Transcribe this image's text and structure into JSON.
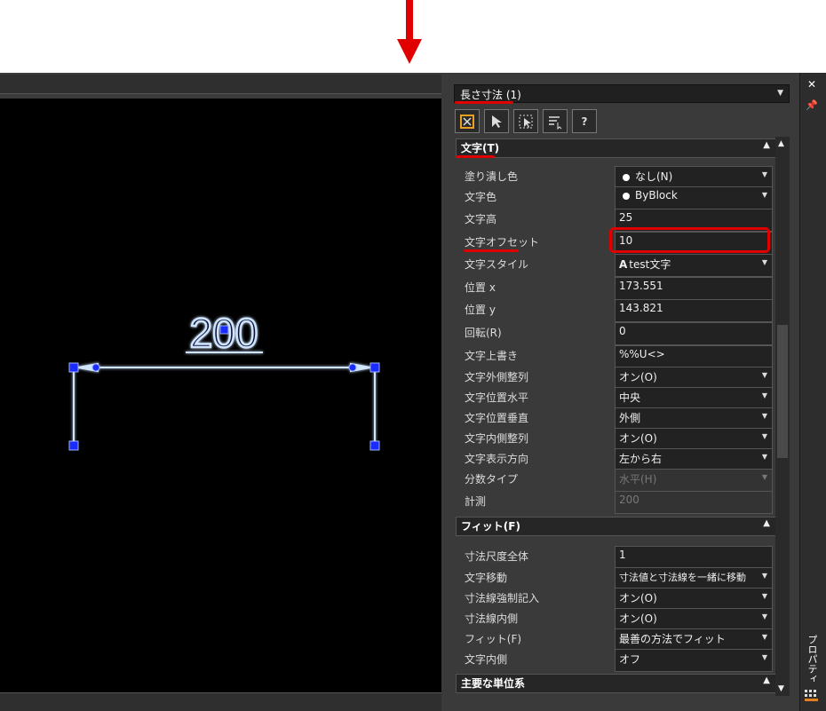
{
  "selector": {
    "value": "長さ寸法 (1)"
  },
  "toolbar": {
    "help_label": "?"
  },
  "sections": {
    "text": {
      "title": "文字(T)"
    },
    "fit": {
      "title": "フィット(F)"
    },
    "units": {
      "title": "主要な単位系"
    }
  },
  "text_props": [
    {
      "label": "塗り潰し色",
      "value": "なし(N)"
    },
    {
      "label": "文字色",
      "value": "ByBlock"
    },
    {
      "label": "文字高",
      "value": "25"
    },
    {
      "label": "文字オフセット",
      "value": "10"
    },
    {
      "label": "文字スタイル",
      "value": "test文字"
    },
    {
      "label": "位置 x",
      "value": "173.551"
    },
    {
      "label": "位置 y",
      "value": "143.821"
    },
    {
      "label": "回転(R)",
      "value": "0"
    },
    {
      "label": "文字上書き",
      "value": "%%U<>"
    },
    {
      "label": "文字外側整列",
      "value": "オン(O)"
    },
    {
      "label": "文字位置水平",
      "value": "中央"
    },
    {
      "label": "文字位置垂直",
      "value": "外側"
    },
    {
      "label": "文字内側整列",
      "value": "オン(O)"
    },
    {
      "label": "文字表示方向",
      "value": "左から右"
    },
    {
      "label": "分数タイプ",
      "value": "水平(H)"
    },
    {
      "label": "計測",
      "value": "200"
    }
  ],
  "fit_props": [
    {
      "label": "寸法尺度全体",
      "value": "1"
    },
    {
      "label": "文字移動",
      "value": "寸法値と寸法線を一緒に移動"
    },
    {
      "label": "寸法線強制記入",
      "value": "オン(O)"
    },
    {
      "label": "寸法線内側",
      "value": "オン(O)"
    },
    {
      "label": "フィット(F)",
      "value": "最善の方法でフィット"
    },
    {
      "label": "文字内側",
      "value": "オフ"
    }
  ],
  "drawing": {
    "dimension_text": "200"
  },
  "right_strip": {
    "panel_tab": "プロパティ",
    "close_glyph": "✕",
    "pin_glyph": "📌"
  },
  "colors": {
    "accent": "#e00000",
    "grip": "#1a2bff",
    "dimension": "#cfe4ff"
  }
}
